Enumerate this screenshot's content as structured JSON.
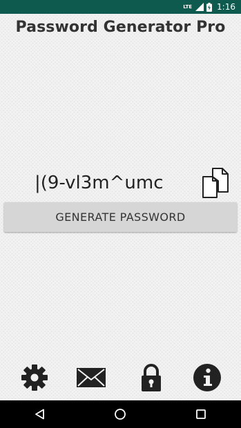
{
  "status_bar": {
    "network": "LTE",
    "time": "1:16"
  },
  "app": {
    "title": "Password Generator Pro"
  },
  "password": {
    "value": "|(9-vl3m^umc"
  },
  "actions": {
    "generate_label": "GENERATE PASSWORD"
  },
  "toolbar": {
    "icons": [
      "settings-gear-icon",
      "email-envelope-icon",
      "lock-icon",
      "info-icon"
    ]
  },
  "navigation": {
    "buttons": [
      "back-triangle-icon",
      "home-circle-icon",
      "recents-square-icon"
    ]
  },
  "colors": {
    "status_bar": "#0e5a4e",
    "button_bg": "#d6d6d6",
    "icon": "#222222",
    "nav_bar": "#000000"
  }
}
